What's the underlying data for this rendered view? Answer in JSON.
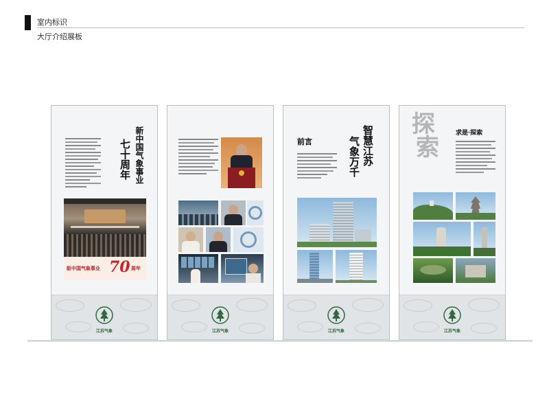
{
  "header": {
    "section_title": "室内标识",
    "subtitle": "大厅介绍展板"
  },
  "panels": [
    {
      "id": "panel-1",
      "title": "新中国气象事业七十周年",
      "title_col1": "新中国气象事业",
      "title_col2": "七十周年",
      "banner_text": "新中国气象事业",
      "banner_number": "70",
      "banner_suffix": "周年",
      "footer_logo_text": "江苏气象"
    },
    {
      "id": "panel-2",
      "footer_logo_text": "江苏气象"
    },
    {
      "id": "panel-3",
      "title_col1": "智慧江苏",
      "title_col2": "气象万千",
      "heading": "前言",
      "footer_logo_text": "江苏气象"
    },
    {
      "id": "panel-4",
      "watermark_1": "探",
      "watermark_2": "索",
      "heading": "求是·探索",
      "footer_logo_text": "江苏气象"
    }
  ],
  "colors": {
    "panel_bg": "#f3f5f6",
    "footer_bg": "#e1e4e6",
    "logo_green": "#2d6b3c",
    "banner_red": "#c8262c"
  }
}
